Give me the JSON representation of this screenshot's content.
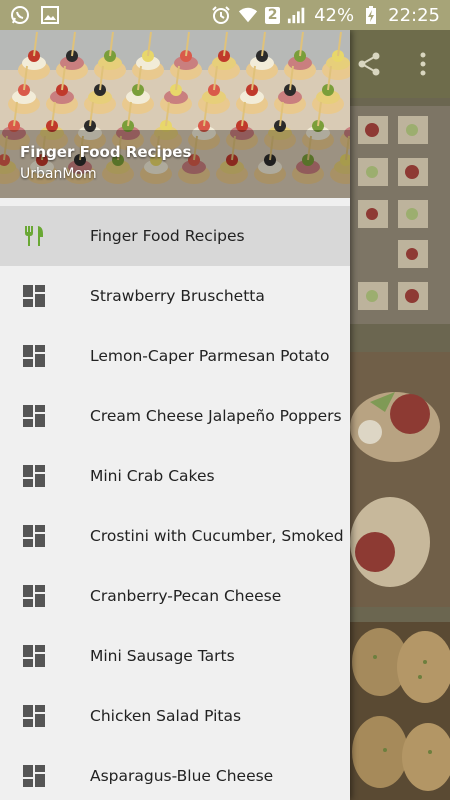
{
  "status_bar": {
    "left_icons": [
      "whatsapp-icon",
      "image-icon"
    ],
    "sim_label": "2",
    "battery_percent": "42%",
    "time": "22:25"
  },
  "drawer": {
    "header": {
      "title": "Finger Food Recipes",
      "subtitle": "UrbanMom"
    },
    "items": [
      {
        "label": "Finger Food Recipes",
        "icon": "restaurant-icon",
        "active": true
      },
      {
        "label": "Strawberry Bruschetta",
        "icon": "dashboard-icon"
      },
      {
        "label": "Lemon-Caper Parmesan Potato",
        "icon": "dashboard-icon"
      },
      {
        "label": "Cream Cheese Jalapeño Poppers",
        "icon": "dashboard-icon"
      },
      {
        "label": "Mini Crab Cakes",
        "icon": "dashboard-icon"
      },
      {
        "label": "Crostini with Cucumber, Smoked",
        "icon": "dashboard-icon"
      },
      {
        "label": "Cranberry-Pecan Cheese",
        "icon": "dashboard-icon"
      },
      {
        "label": "Mini Sausage Tarts",
        "icon": "dashboard-icon"
      },
      {
        "label": "Chicken Salad Pitas",
        "icon": "dashboard-icon"
      },
      {
        "label": "Asparagus-Blue Cheese",
        "icon": "dashboard-icon"
      }
    ]
  },
  "colors": {
    "status_bar": "#a7a478",
    "toolbar": "#6e6c4b",
    "active_icon": "#6aa834",
    "drawer_bg": "#f0f0f0",
    "active_row": "#d8d8d8"
  }
}
